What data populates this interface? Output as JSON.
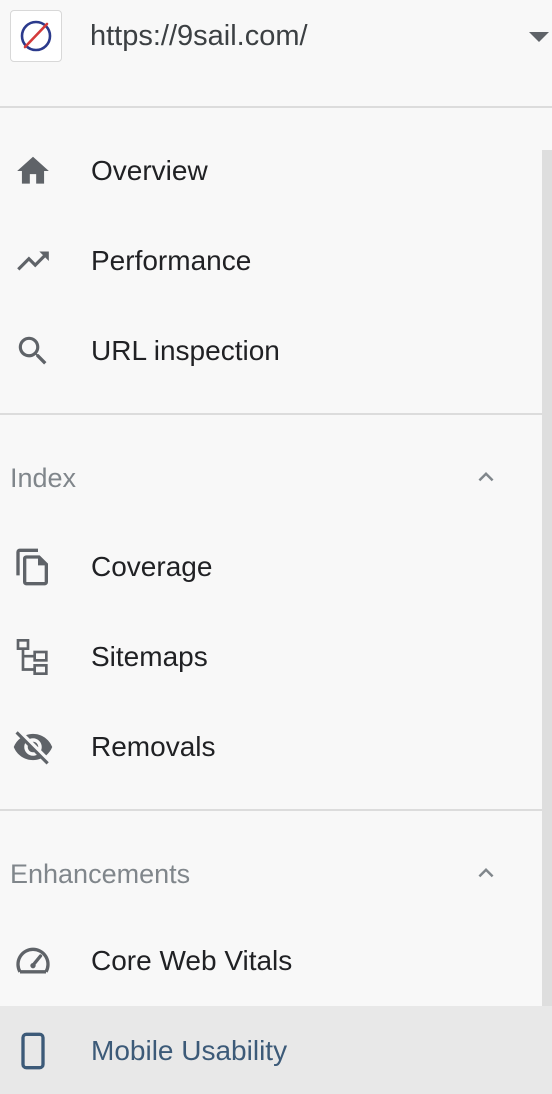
{
  "property": {
    "url": "https://9sail.com/",
    "favicon_icon": "compass-icon",
    "dropdown_icon": "caret-down-icon"
  },
  "nav": {
    "top_items": [
      {
        "label": "Overview",
        "icon": "home-icon"
      },
      {
        "label": "Performance",
        "icon": "trending-up-icon"
      },
      {
        "label": "URL inspection",
        "icon": "search-icon"
      }
    ],
    "sections": [
      {
        "title": "Index",
        "expanded": true,
        "items": [
          {
            "label": "Coverage",
            "icon": "copy-pages-icon"
          },
          {
            "label": "Sitemaps",
            "icon": "sitemap-icon"
          },
          {
            "label": "Removals",
            "icon": "eye-off-icon"
          }
        ]
      },
      {
        "title": "Enhancements",
        "expanded": true,
        "items": [
          {
            "label": "Core Web Vitals",
            "icon": "speedometer-icon"
          },
          {
            "label": "Mobile Usability",
            "icon": "smartphone-icon",
            "active": true
          }
        ]
      }
    ]
  },
  "colors": {
    "background": "#f8f8f8",
    "active_background": "#e8e8e8",
    "active_text": "#3c5a78",
    "icon": "#5f6368",
    "section_title": "#80868b"
  }
}
